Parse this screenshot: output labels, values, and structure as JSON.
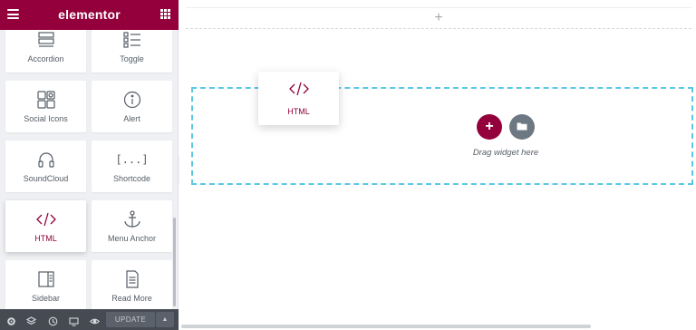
{
  "panel": {
    "brand": "elementor",
    "widgets": [
      {
        "label": "Accordion",
        "icon": "accordion-icon"
      },
      {
        "label": "Toggle",
        "icon": "toggle-icon"
      },
      {
        "label": "Social Icons",
        "icon": "social-icons-icon"
      },
      {
        "label": "Alert",
        "icon": "alert-icon"
      },
      {
        "label": "SoundCloud",
        "icon": "headphones-icon"
      },
      {
        "label": "Shortcode",
        "icon": "shortcode-icon",
        "glyph": "[...]"
      },
      {
        "label": "HTML",
        "icon": "code-icon",
        "active": true
      },
      {
        "label": "Menu Anchor",
        "icon": "anchor-icon"
      },
      {
        "label": "Sidebar",
        "icon": "sidebar-icon"
      },
      {
        "label": "Read More",
        "icon": "read-more-icon"
      }
    ],
    "footer": {
      "icons": [
        "settings-icon",
        "layers-icon",
        "history-icon",
        "responsive-icon",
        "preview-icon"
      ],
      "update_label": "UPDATE"
    }
  },
  "canvas": {
    "drop_text": "Drag widget here",
    "drag_widget_label": "HTML"
  },
  "colors": {
    "brand": "#93003c",
    "drop_outline": "#5bc7e6"
  }
}
